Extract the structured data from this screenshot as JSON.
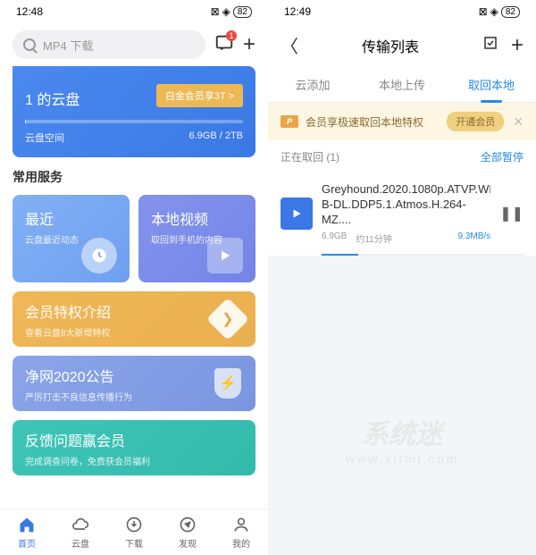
{
  "left": {
    "status": {
      "time": "12:48",
      "battery": "82"
    },
    "search_placeholder": "MP4 下载",
    "chat_badge": "1",
    "cloud": {
      "title": "1 的云盘",
      "vip_btn": "白金会员享3T >",
      "storage_label": "云盘空间",
      "storage_usage": "6.9GB / 2TB"
    },
    "section_title": "常用服务",
    "tiles": {
      "recent": {
        "title": "最近",
        "sub": "云盘最近动态"
      },
      "local_video": {
        "title": "本地视频",
        "sub": "取回到手机的内容"
      },
      "vip_intro": {
        "title": "会员特权介绍",
        "sub": "查看云盘8大新增特权"
      },
      "clean": {
        "title": "净网2020公告",
        "sub": "严厉打击不良信息传播行为"
      },
      "feedback": {
        "title": "反馈问题赢会员",
        "sub": "完成调查问卷，免费获会员福利"
      }
    },
    "nav": [
      "首页",
      "云盘",
      "下载",
      "发现",
      "我的"
    ]
  },
  "right": {
    "status": {
      "time": "12:49",
      "battery": "82"
    },
    "title": "传输列表",
    "tabs": [
      "云添加",
      "本地上传",
      "取回本地"
    ],
    "banner": {
      "text": "会员享极速取回本地特权",
      "btn": "开通会员"
    },
    "task_header": {
      "label": "正在取回 (1)",
      "pause": "全部暂停"
    },
    "task": {
      "name1": "Greyhound.2020.1080p.ATVP.WE",
      "name2": "B-DL.DDP5.1.Atmos.H.264-MZ....",
      "size": "6.9GB",
      "eta": "约11分钟",
      "speed": "9.3MB/s"
    },
    "watermark": {
      "big": "系统迷",
      "small": "www.xitmi.com"
    }
  }
}
